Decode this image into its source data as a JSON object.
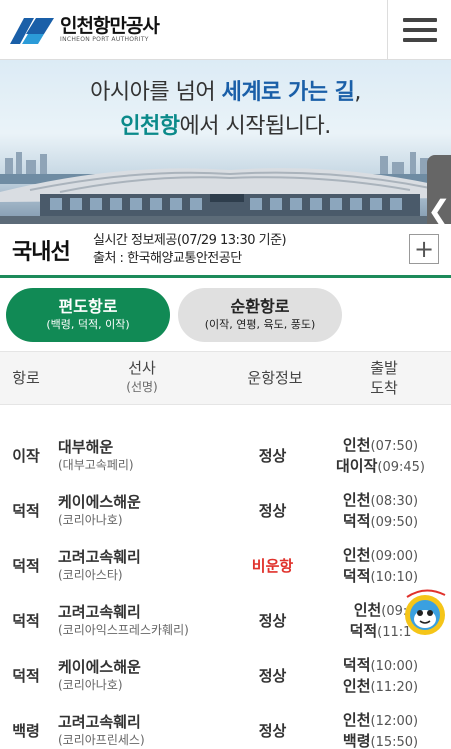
{
  "header": {
    "logo_ko": "인천항만공사",
    "logo_en": "INCHEON PORT AUTHORITY",
    "logo_icon": "ipa-logo-mark",
    "menu_icon": "hamburger-icon"
  },
  "banner": {
    "line1_pre": "아시아를 넘어 ",
    "line1_hl": "세계로 가는 길",
    "line1_post": ",",
    "line2_hl": "인천항",
    "line2_post": "에서 시작됩니다.",
    "side_tab_icon": "chevron-left-icon"
  },
  "domestic": {
    "title": "국내선",
    "realtime": "실시간 정보제공(07/29 13:30 기준)",
    "source": "출처 : 한국해양교통안전공단",
    "expand_label": "+"
  },
  "tabs": [
    {
      "label": "편도항로",
      "sub": "(백령, 덕적, 이작)",
      "active": true
    },
    {
      "label": "순환항로",
      "sub": "(이작, 연평, 육도, 풍도)",
      "active": false
    }
  ],
  "table": {
    "col_route": "항로",
    "col_carrier": "선사",
    "col_carrier_sub": "(선명)",
    "col_status": "운항정보",
    "col_time_1": "출발",
    "col_time_2": "도착",
    "rows": [
      {
        "route": "이작",
        "carrier": "대부해운",
        "ship": "(대부고속페리)",
        "status": "정상",
        "dep_port": "인천",
        "dep_time": "(07:50)",
        "arr_port": "대이작",
        "arr_time": "(09:45)"
      },
      {
        "route": "덕적",
        "carrier": "케이에스해운",
        "ship": "(코리아나호)",
        "status": "정상",
        "dep_port": "인천",
        "dep_time": "(08:30)",
        "arr_port": "덕적",
        "arr_time": "(09:50)"
      },
      {
        "route": "덕적",
        "carrier": "고려고속훼리",
        "ship": "(코리아스타)",
        "status": "비운항",
        "dep_port": "인천",
        "dep_time": "(09:00)",
        "arr_port": "덕적",
        "arr_time": "(10:10)"
      },
      {
        "route": "덕적",
        "carrier": "고려고속훼리",
        "ship": "(코리아익스프레스카훼리)",
        "status": "정상",
        "dep_port": "인천",
        "dep_time": "(09:",
        "arr_port": "덕적",
        "arr_time": "(11:1"
      },
      {
        "route": "덕적",
        "carrier": "케이에스해운",
        "ship": "(코리아나호)",
        "status": "정상",
        "dep_port": "덕적",
        "dep_time": "(10:00)",
        "arr_port": "인천",
        "arr_time": "(11:20)"
      },
      {
        "route": "백령",
        "carrier": "고려고속훼리",
        "ship": "(코리아프린세스)",
        "status": "정상",
        "dep_port": "인천",
        "dep_time": "(12:00)",
        "arr_port": "백령",
        "arr_time": "(15:50)"
      }
    ]
  },
  "colors": {
    "brand_green": "#118a55",
    "brand_blue": "#1a5fa8",
    "alert_red": "#e0322c"
  },
  "mascot_icon": "mascot-character-icon"
}
